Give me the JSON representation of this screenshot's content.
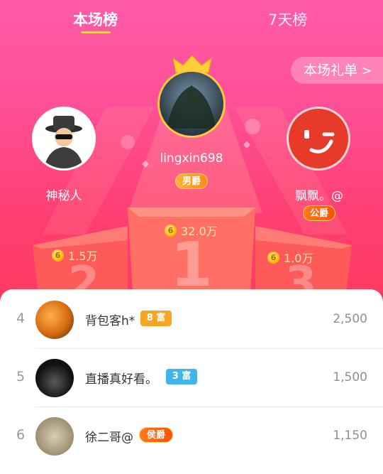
{
  "tabs": [
    {
      "label": "本场榜",
      "active": true
    },
    {
      "label": "7天榜",
      "active": false
    }
  ],
  "gift_button": {
    "label": "本场礼单",
    "icon": "chevron-right-icon"
  },
  "podium": {
    "first": {
      "name": "lingxin698",
      "badge": "男爵",
      "score": "32.0万",
      "rank": "1"
    },
    "second": {
      "name": "神秘人",
      "score": "1.5万",
      "rank": "2"
    },
    "third": {
      "name": "飘飘。@",
      "badge": "公爵",
      "score": "1.0万",
      "rank": "3"
    }
  },
  "coin_glyph": "6",
  "leaderboard": [
    {
      "rank": "4",
      "name": "背包客h*",
      "tag": "8 富",
      "score": "2,500"
    },
    {
      "rank": "5",
      "name": "直播真好看。",
      "tag": "3 富",
      "score": "1,500"
    },
    {
      "rank": "6",
      "name": "徐二哥@",
      "tag": "侯爵",
      "score": "1,150"
    }
  ],
  "colors": {
    "accent_gold": "#ffd34d",
    "tag_rich_orange": "#f6a623",
    "tag_rich_blue": "#3eb6ea",
    "noble_badge": "#ff7a1a"
  }
}
